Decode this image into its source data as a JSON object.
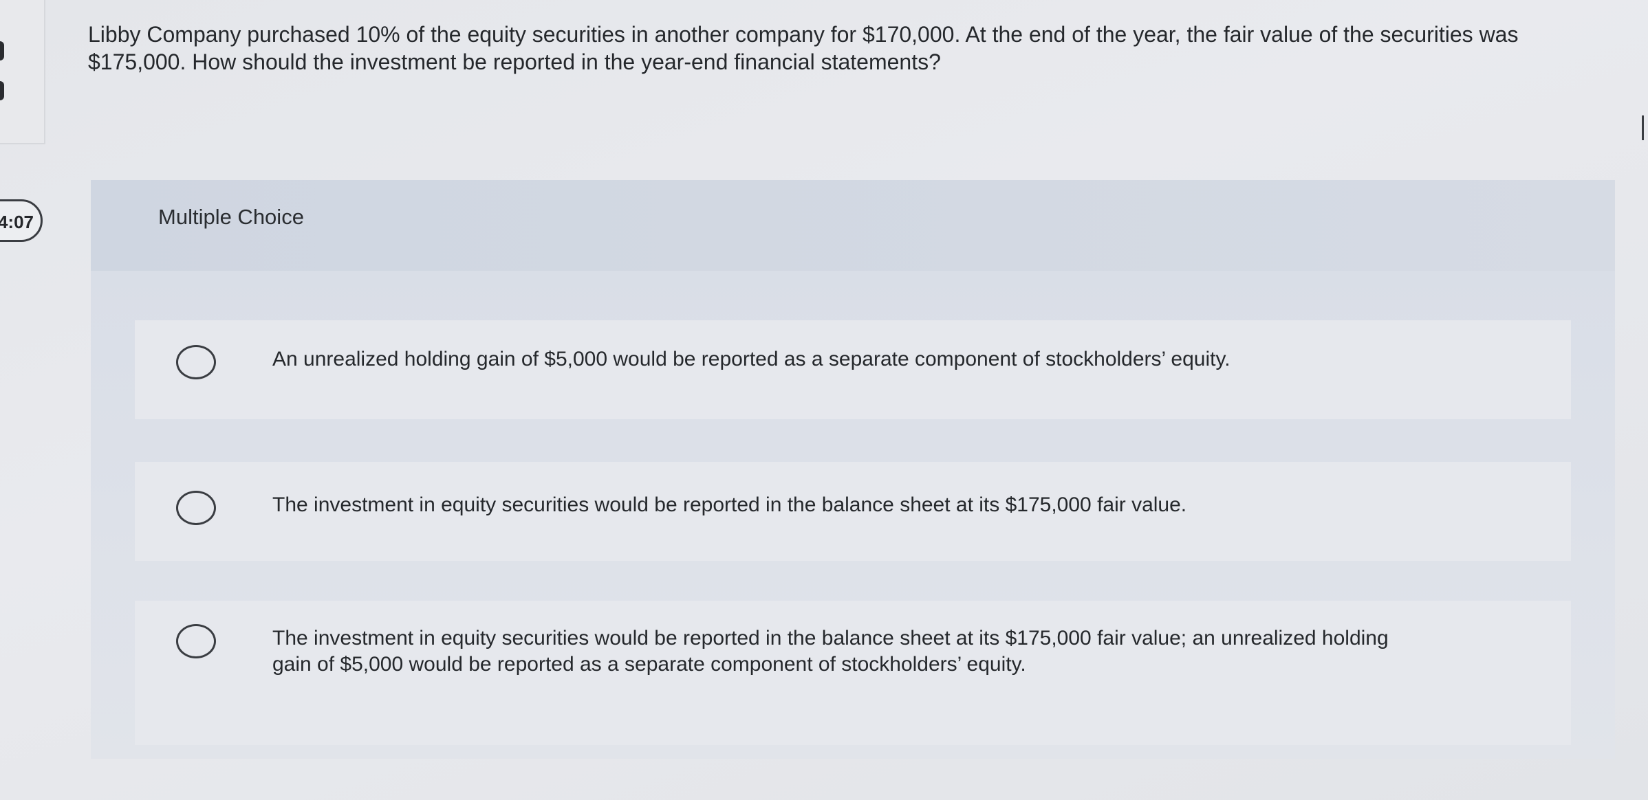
{
  "timer": {
    "text": "4:07"
  },
  "question": {
    "text": "Libby Company purchased 10% of the equity securities in another company for $170,000. At the end of the year, the fair value of the securities was $175,000. How should the investment be reported in the year-end financial statements?"
  },
  "multiple_choice": {
    "title": "Multiple Choice",
    "options": [
      {
        "label": "An unrealized holding gain of $5,000 would be reported as a separate component of stockholders’ equity.",
        "selected": false
      },
      {
        "label": "The investment in equity securities would be reported in the balance sheet at its $175,000 fair value.",
        "selected": false
      },
      {
        "label": "The investment in equity securities would be reported in the balance sheet at its $175,000 fair value; an unrealized holding gain of $5,000 would be reported as a separate component of stockholders’ equity.",
        "selected": false
      }
    ]
  },
  "colors": {
    "background": "#e6e8ec",
    "header_band": "#d3d9e3",
    "choice_card": "#e6e8ed",
    "text": "#25282c"
  }
}
